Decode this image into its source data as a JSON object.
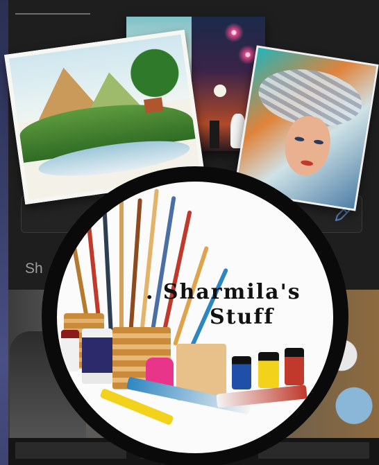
{
  "form": {
    "section_label": "Sh"
  },
  "logo": {
    "line1": ". Sharmila's",
    "line2": "Stuff"
  },
  "colors": {
    "panel": "#1e1e1e",
    "ring": "#0a0a0a",
    "accent_icon": "#4f7fb8"
  },
  "icons": [
    "pencil-icon"
  ]
}
